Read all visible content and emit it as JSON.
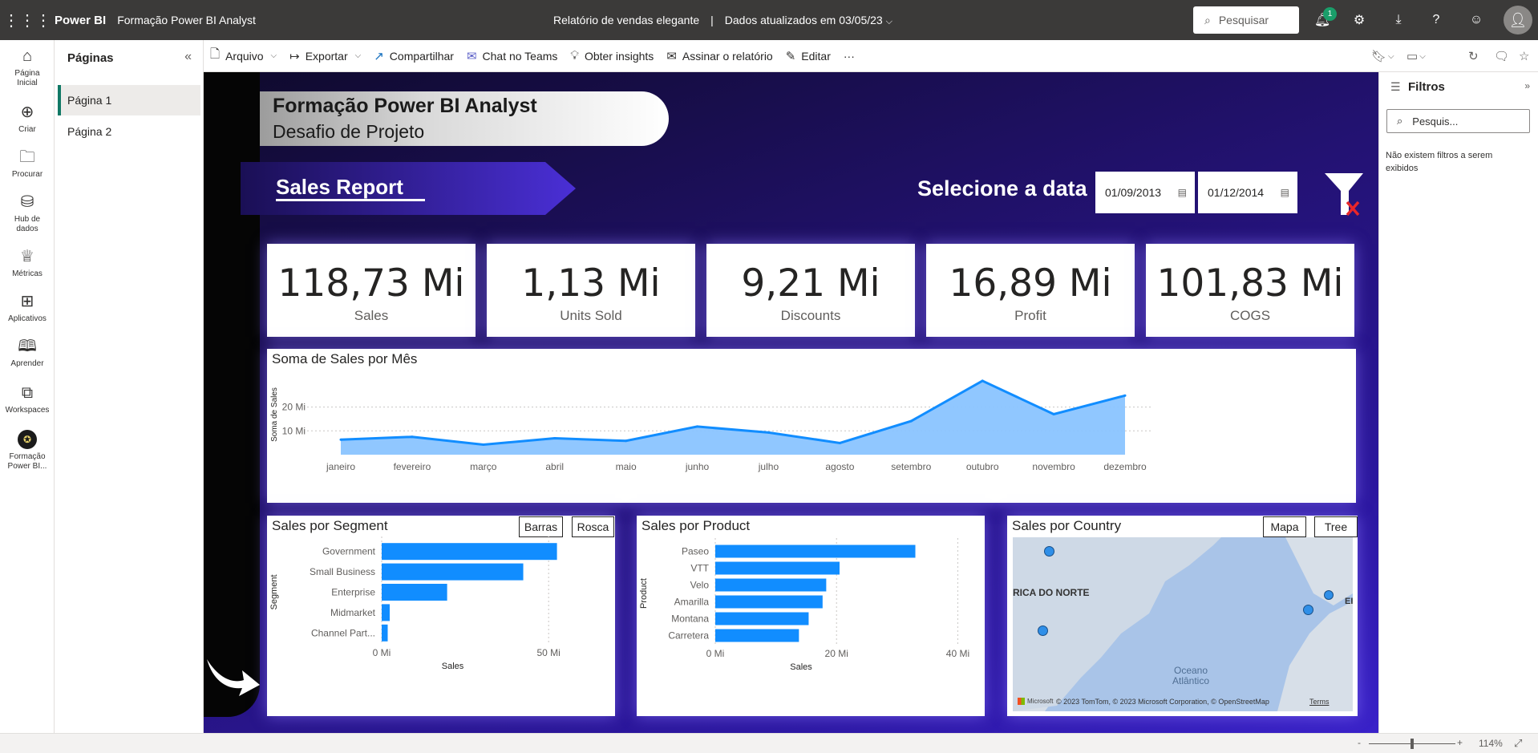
{
  "topbar": {
    "app_name": "Power BI",
    "workspace": "Formação Power BI Analyst",
    "report_title": "Relatório de vendas elegante",
    "separator": "|",
    "updated": "Dados atualizados em 03/05/23",
    "search_placeholder": "Pesquisar",
    "notification_count": "1",
    "icons": [
      "waffle-icon",
      "bell-icon",
      "gear-icon",
      "download-icon",
      "help-icon",
      "smiley-icon",
      "avatar"
    ]
  },
  "leftnav": [
    {
      "label": "Página Inicial",
      "icon": "home-icon"
    },
    {
      "label": "Criar",
      "icon": "create-icon"
    },
    {
      "label": "Procurar",
      "icon": "folder-icon"
    },
    {
      "label": "Hub de dados",
      "icon": "database-icon"
    },
    {
      "label": "Métricas",
      "icon": "trophy-icon"
    },
    {
      "label": "Aplicativos",
      "icon": "apps-icon"
    },
    {
      "label": "Aprender",
      "icon": "book-icon"
    },
    {
      "label": "Workspaces",
      "icon": "workspaces-icon"
    },
    {
      "label": "Formação Power BI...",
      "icon": "workspace-logo-icon"
    }
  ],
  "pages": {
    "title": "Páginas",
    "items": [
      "Página 1",
      "Página 2"
    ],
    "active": "Página 1"
  },
  "ribbon": {
    "arquivo": "Arquivo",
    "exportar": "Exportar",
    "compartilhar": "Compartilhar",
    "chat": "Chat no Teams",
    "insights": "Obter insights",
    "assinar": "Assinar o relatório",
    "editar": "Editar",
    "more": "···"
  },
  "report": {
    "title_line1": "Formação Power BI Analyst",
    "title_line2": "Desafio de Projeto",
    "sales_report": "Sales Report",
    "select_date": "Selecione a data",
    "date_start": "01/09/2013",
    "date_end": "01/12/2014",
    "kpis": [
      {
        "value": "118,73 Mi",
        "label": "Sales"
      },
      {
        "value": "1,13 Mi",
        "label": "Units Sold"
      },
      {
        "value": "9,21 Mi",
        "label": "Discounts"
      },
      {
        "value": "16,89 Mi",
        "label": "Profit"
      },
      {
        "value": "101,83 Mi",
        "label": "COGS"
      }
    ],
    "segment_buttons": [
      "Barras",
      "Rosca"
    ],
    "country_buttons": [
      "Mapa",
      "Tree"
    ],
    "map": {
      "title": "Sales por Country",
      "region_label": "RICA DO NORTE",
      "ocean_label_1": "Oceano",
      "ocean_label_2": "Atlântico",
      "edge_label": "EI",
      "attribution": "© 2023 TomTom, © 2023 Microsoft Corporation, © OpenStreetMap",
      "terms": "Terms",
      "microsoft": "Microsoft"
    },
    "accent": "#118dff",
    "area_fill": "#8ac4ff"
  },
  "chart_data": [
    {
      "type": "area",
      "title": "Soma de Sales por Mês",
      "ylabel": "Soma de Sales",
      "categories": [
        "janeiro",
        "fevereiro",
        "março",
        "abril",
        "maio",
        "junho",
        "julho",
        "agosto",
        "setembro",
        "outubro",
        "novembro",
        "dezembro"
      ],
      "values": [
        6.3,
        7.5,
        4.2,
        6.9,
        5.8,
        11.8,
        9.3,
        4.9,
        14.1,
        31.0,
        17.0,
        24.8
      ],
      "yticks": [
        "10 Mi",
        "20 Mi"
      ],
      "ytick_values": [
        10,
        20
      ],
      "ylim": [
        0,
        35
      ]
    },
    {
      "type": "bar",
      "title": "Sales por Segment",
      "ylabel": "Segment",
      "xlabel": "Sales",
      "categories": [
        "Government",
        "Small Business",
        "Enterprise",
        "Midmarket",
        "Channel Part..."
      ],
      "values": [
        52.5,
        42.4,
        19.6,
        2.4,
        1.8
      ],
      "xticks": [
        "0 Mi",
        "50 Mi"
      ],
      "xtick_values": [
        0,
        50
      ],
      "xlim": [
        0,
        55
      ]
    },
    {
      "type": "bar",
      "title": "Sales por Product",
      "ylabel": "Product",
      "xlabel": "Sales",
      "categories": [
        "Paseo",
        "VTT",
        "Velo",
        "Amarilla",
        "Montana",
        "Carretera"
      ],
      "values": [
        33.0,
        20.5,
        18.3,
        17.7,
        15.4,
        13.8
      ],
      "xticks": [
        "0 Mi",
        "20 Mi",
        "40 Mi"
      ],
      "xtick_values": [
        0,
        20,
        40
      ],
      "xlim": [
        0,
        41
      ]
    }
  ],
  "filters": {
    "title": "Filtros",
    "search_placeholder": "Pesquis...",
    "empty": "Não existem filtros a serem exibidos"
  },
  "status": {
    "zoom": "114%",
    "minus": "-",
    "plus": "+"
  }
}
